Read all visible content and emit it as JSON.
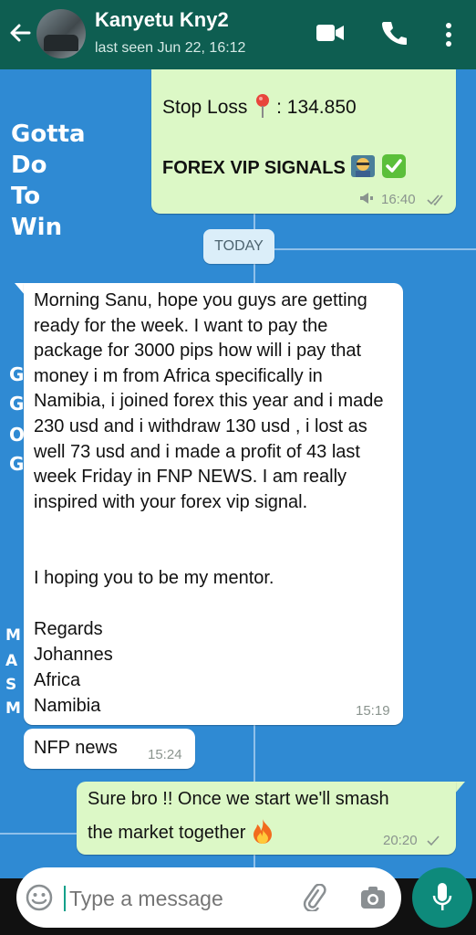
{
  "header": {
    "contact_name": "Kanyetu Kny2",
    "last_seen": "last seen Jun 22, 16:12"
  },
  "background_text": {
    "lines": [
      "Gotta",
      "Do",
      "To",
      "Win"
    ],
    "left_letters_mid": [
      "G",
      "G",
      "O",
      "G"
    ],
    "left_letters_low": [
      "M",
      "A",
      "S",
      "M"
    ]
  },
  "messages": [
    {
      "direction": "out",
      "text_line1": "Stop Loss",
      "text_line1_value": ": 134.850",
      "text_line2": "FOREX VIP SIGNALS",
      "time": "16:40"
    },
    {
      "direction": "in",
      "paragraph1": "Morning Sanu, hope you guys are getting ready for the week. I want to pay the package for 3000 pips how will i pay that money i m from Africa specifically in Namibia,  i joined forex this year and i made  230 usd and i withdraw 130 usd , i lost as well 73 usd and i made a profit of 43 last week Friday in FNP NEWS. I am really inspired with your forex vip signal.",
      "paragraph2": "I hoping you to be my mentor.",
      "sign_lines": [
        "Regards",
        "Johannes",
        "Africa",
        "Namibia"
      ],
      "time": "15:19"
    },
    {
      "direction": "in",
      "text": "NFP news",
      "time": "15:24"
    },
    {
      "direction": "out",
      "line1": "Sure bro !! Once we start we'll smash",
      "line2": "the market together",
      "time": "20:20"
    }
  ],
  "date_chip": "TODAY",
  "input": {
    "placeholder": "Type a message"
  },
  "colors": {
    "header": "#0e5e51",
    "chat_background": "#2f8ad3",
    "outgoing_bubble": "#dcf8c6",
    "incoming_bubble": "#ffffff",
    "mic_button": "#0e8a7b"
  },
  "icons": [
    "back-arrow-icon",
    "video-call-icon",
    "phone-icon",
    "more-vert-icon",
    "pin-icon",
    "teacher-emoji-icon",
    "check-mark-emoji-icon",
    "broadcast-icon",
    "double-tick-icon",
    "single-tick-icon",
    "fire-emoji-icon",
    "emoji-icon",
    "attach-icon",
    "camera-icon",
    "mic-icon"
  ]
}
